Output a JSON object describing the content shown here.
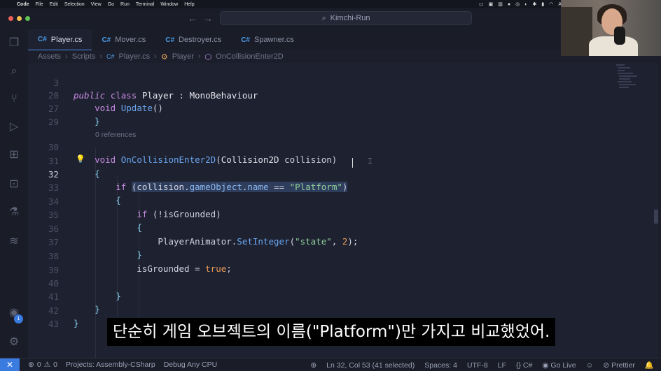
{
  "menubar": {
    "app": "Code",
    "items": [
      "File",
      "Edit",
      "Selection",
      "View",
      "Go",
      "Run",
      "Terminal",
      "Window",
      "Help"
    ],
    "right_letter": "A"
  },
  "titlebar": {
    "search": "Kimchi-Run"
  },
  "tabs": [
    {
      "icon": "C#",
      "label": "Player.cs"
    },
    {
      "icon": "C#",
      "label": "Mover.cs"
    },
    {
      "icon": "C#",
      "label": "Destroyer.cs"
    },
    {
      "icon": "C#",
      "label": "Spawner.cs"
    }
  ],
  "breadcrumb": [
    "Assets",
    "Scripts",
    "Player.cs",
    "Player",
    "OnCollisionEnter2D"
  ],
  "editor": {
    "references": "0 references",
    "lines": [
      {
        "n": "3"
      },
      {
        "n": "20"
      },
      {
        "n": "27"
      },
      {
        "n": "29"
      },
      {
        "n": "30"
      },
      {
        "n": "31"
      },
      {
        "n": "32"
      },
      {
        "n": "33"
      },
      {
        "n": "34"
      },
      {
        "n": "35"
      },
      {
        "n": "36"
      },
      {
        "n": "37"
      },
      {
        "n": "38"
      },
      {
        "n": "39"
      },
      {
        "n": "40"
      },
      {
        "n": "41"
      },
      {
        "n": "42"
      },
      {
        "n": "43"
      }
    ]
  },
  "activity_badge": "1",
  "statusbar": {
    "errors": "0",
    "warnings": "0",
    "project": "Projects: Assembly-CSharp",
    "debug": "Debug Any CPU",
    "position": "Ln 32, Col 53 (41 selected)",
    "spaces": "Spaces: 4",
    "encoding": "UTF-8",
    "eol": "LF",
    "language": "C#",
    "golive": "Go Live",
    "prettier": "Prettier"
  },
  "subtitle": "단순히 게임 오브젝트의 이름(\"Platform\")만 가지고 비교했었어."
}
